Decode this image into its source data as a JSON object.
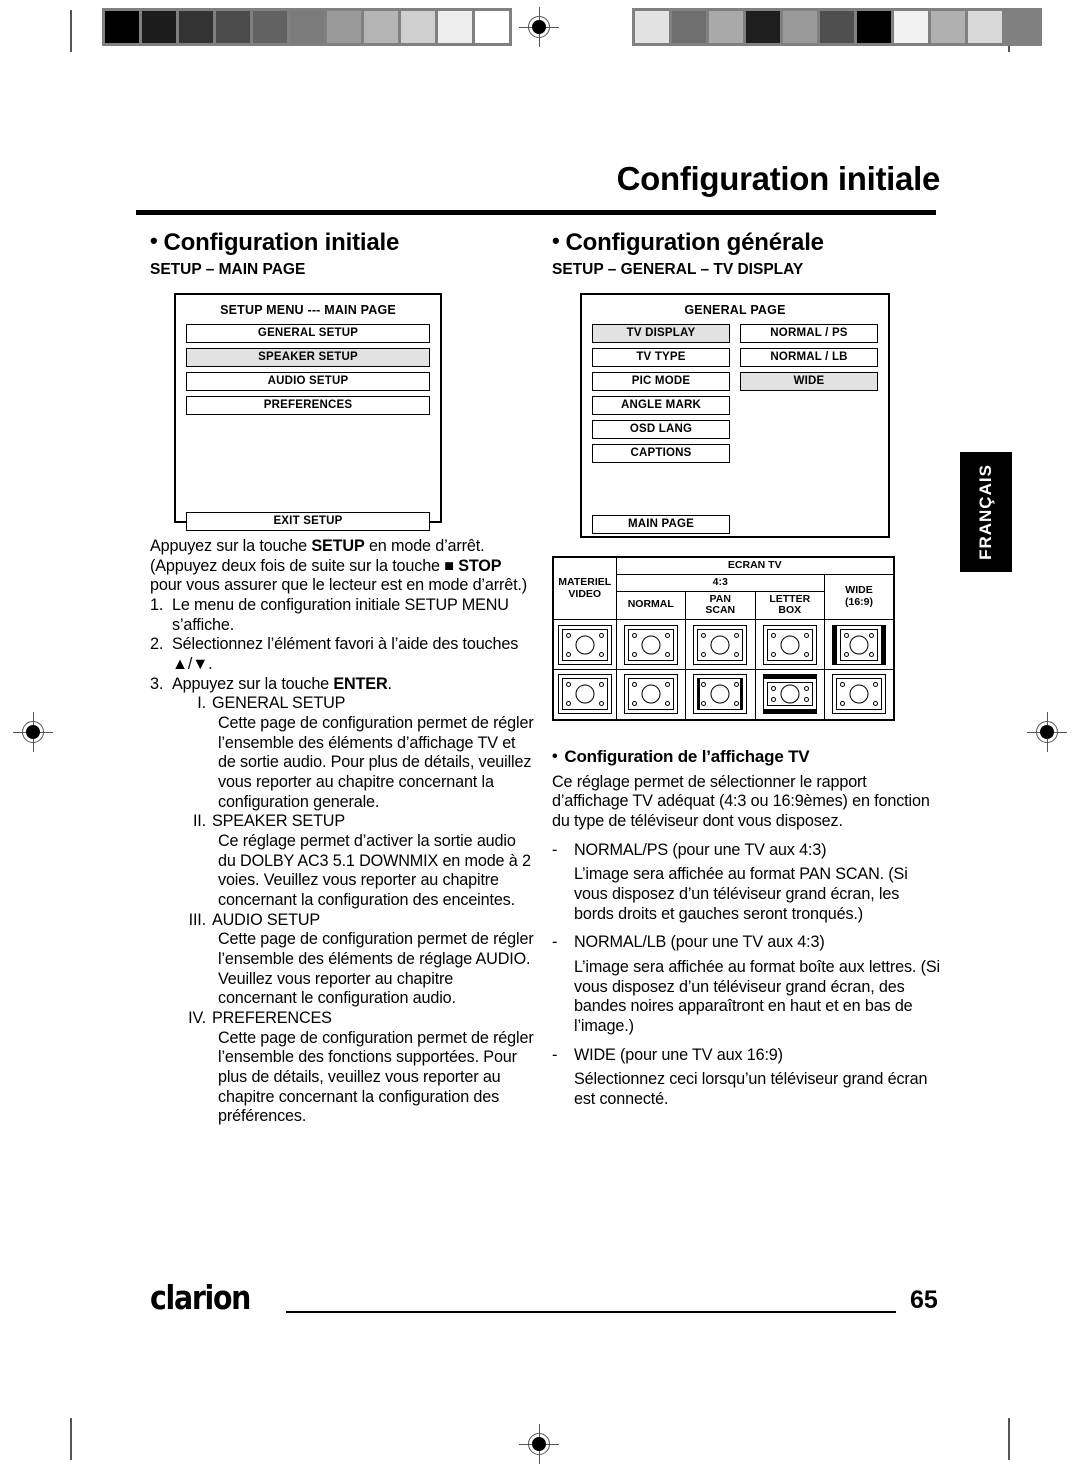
{
  "calibration": {
    "left_bar": [
      "#000000",
      "#1c1c1c",
      "#323232",
      "#4b4b4b",
      "#626262",
      "#7b7b7b",
      "#9a9a9a",
      "#b4b4b4",
      "#cfcfcf",
      "#ededed",
      "#ffffff"
    ],
    "right_bar": [
      "#e2e2e2",
      "#6e6e6e",
      "#a9a9a9",
      "#1e1e1e",
      "#9a9a9a",
      "#4f4f4f",
      "#000000",
      "#f2f2f2",
      "#b0b0b0",
      "#d8d8d8",
      "#808080"
    ]
  },
  "header": {
    "title": "Configuration initiale"
  },
  "left_column": {
    "bullet": "•",
    "heading": "Configuration initiale",
    "subheading": "SETUP – MAIN PAGE",
    "osd": {
      "title": "SETUP MENU --- MAIN PAGE",
      "items": [
        {
          "label": "GENERAL SETUP",
          "selected": false
        },
        {
          "label": "SPEAKER SETUP",
          "selected": true
        },
        {
          "label": "AUDIO SETUP",
          "selected": false
        },
        {
          "label": "PREFERENCES",
          "selected": false
        }
      ],
      "exit": "EXIT SETUP"
    },
    "intro": {
      "line1_a": "Appuyez sur la touche ",
      "line1_b": "SETUP",
      "line1_c": " en mode d’arrêt. (Appuyez deux fois de suite sur la touche ■ ",
      "line1_d": "STOP",
      "line1_e": " pour vous assurer que le lecteur est en mode d’arrêt.)"
    },
    "steps": [
      {
        "n": "1.",
        "text": "Le menu de configuration initiale SETUP MENU s’affiche."
      },
      {
        "n": "2.",
        "text": "Sélectionnez l’élément favori à l’aide des touches ▲/▼."
      },
      {
        "n": "3.",
        "text_a": "Appuyez sur la touche ",
        "text_b": "ENTER",
        "text_c": "."
      }
    ],
    "romans": [
      {
        "num": "I.",
        "title": "GENERAL SETUP",
        "body": "Cette page de configuration permet de régler l’ensemble des éléments d’affichage TV et de sortie audio. Pour plus de détails, veuillez vous reporter au chapitre concernant la configuration generale."
      },
      {
        "num": "II.",
        "title": "SPEAKER SETUP",
        "body": "Ce réglage permet d’activer la sortie audio du DOLBY AC3 5.1 DOWNMIX en mode à 2 voies. Veuillez vous reporter au chapitre concernant la configuration des enceintes."
      },
      {
        "num": "III.",
        "title": "AUDIO SETUP",
        "body": "Cette page de configuration permet de régler l’ensemble des éléments de réglage AUDIO. Veuillez vous reporter au chapitre concernant le configuration audio."
      },
      {
        "num": "IV.",
        "title": "PREFERENCES",
        "body": "Cette page de configuration permet de régler l’ensemble des fonctions supportées. Pour plus de détails, veuillez vous reporter au chapitre concernant la configuration des préférences."
      }
    ]
  },
  "right_column": {
    "bullet": "•",
    "heading": "Configuration générale",
    "subheading": "SETUP – GENERAL – TV DISPLAY",
    "osd": {
      "title": "GENERAL PAGE",
      "left_items": [
        {
          "label": "TV DISPLAY",
          "selected": true
        },
        {
          "label": "TV TYPE",
          "selected": false
        },
        {
          "label": "PIC MODE",
          "selected": false
        },
        {
          "label": "ANGLE MARK",
          "selected": false
        },
        {
          "label": "OSD LANG",
          "selected": false
        },
        {
          "label": "CAPTIONS",
          "selected": false
        }
      ],
      "right_items": [
        {
          "label": "NORMAL / PS",
          "selected": false
        },
        {
          "label": "NORMAL / LB",
          "selected": false
        },
        {
          "label": "WIDE",
          "selected": true
        }
      ],
      "main_page": "MAIN PAGE"
    },
    "tv_table": {
      "row_header": "MATERIEL VIDEO",
      "row_header_line1": "MATERIEL",
      "row_header_line2": "VIDEO",
      "screen_header": "ECRAN TV",
      "ratio_43": "4:3",
      "col_normal": "NORMAL",
      "col_pan_scan_line1": "PAN",
      "col_pan_scan_line2": "SCAN",
      "col_letter_box_line1": "LETTER",
      "col_letter_box_line2": "BOX",
      "col_wide_line1": "WIDE",
      "col_wide_line2": "(16:9)",
      "rows": [
        {
          "source": "tv-4-3",
          "cells": [
            "tv-plain",
            "tv-plain",
            "tv-plain",
            "tv-side-bars"
          ]
        },
        {
          "source": "tv-16-9",
          "cells": [
            "tv-plain",
            "tv-thin-side",
            "tv-top-bars",
            "tv-plain"
          ]
        }
      ]
    },
    "tv_display_section": {
      "bullet": "•",
      "title": "Configuration de l’affichage TV",
      "intro": "Ce réglage permet de sélectionner le rapport d’affichage TV adéquat (4:3 ou 16:9èmes) en fonction du type de téléviseur dont vous disposez.",
      "options": [
        {
          "dash": "-",
          "label": "NORMAL/PS (pour une TV aux 4:3)",
          "body": "L’image sera affichée au format PAN SCAN. (Si vous disposez d’un téléviseur grand écran, les bords droits et gauches seront tronqués.)"
        },
        {
          "dash": "-",
          "label": "NORMAL/LB (pour une TV aux 4:3)",
          "body": "L’image sera affichée au format boîte aux lettres. (Si vous disposez d’un téléviseur grand écran, des bandes noires apparaîtront en haut et en bas de l’image.)"
        },
        {
          "dash": "-",
          "label": "WIDE (pour une TV aux 16:9)",
          "body": "Sélectionnez ceci lorsqu’un téléviseur grand écran est connecté."
        }
      ]
    }
  },
  "side_tab": {
    "label": "FRANÇAIS"
  },
  "footer": {
    "brand": "clarion",
    "page_number": "65"
  }
}
